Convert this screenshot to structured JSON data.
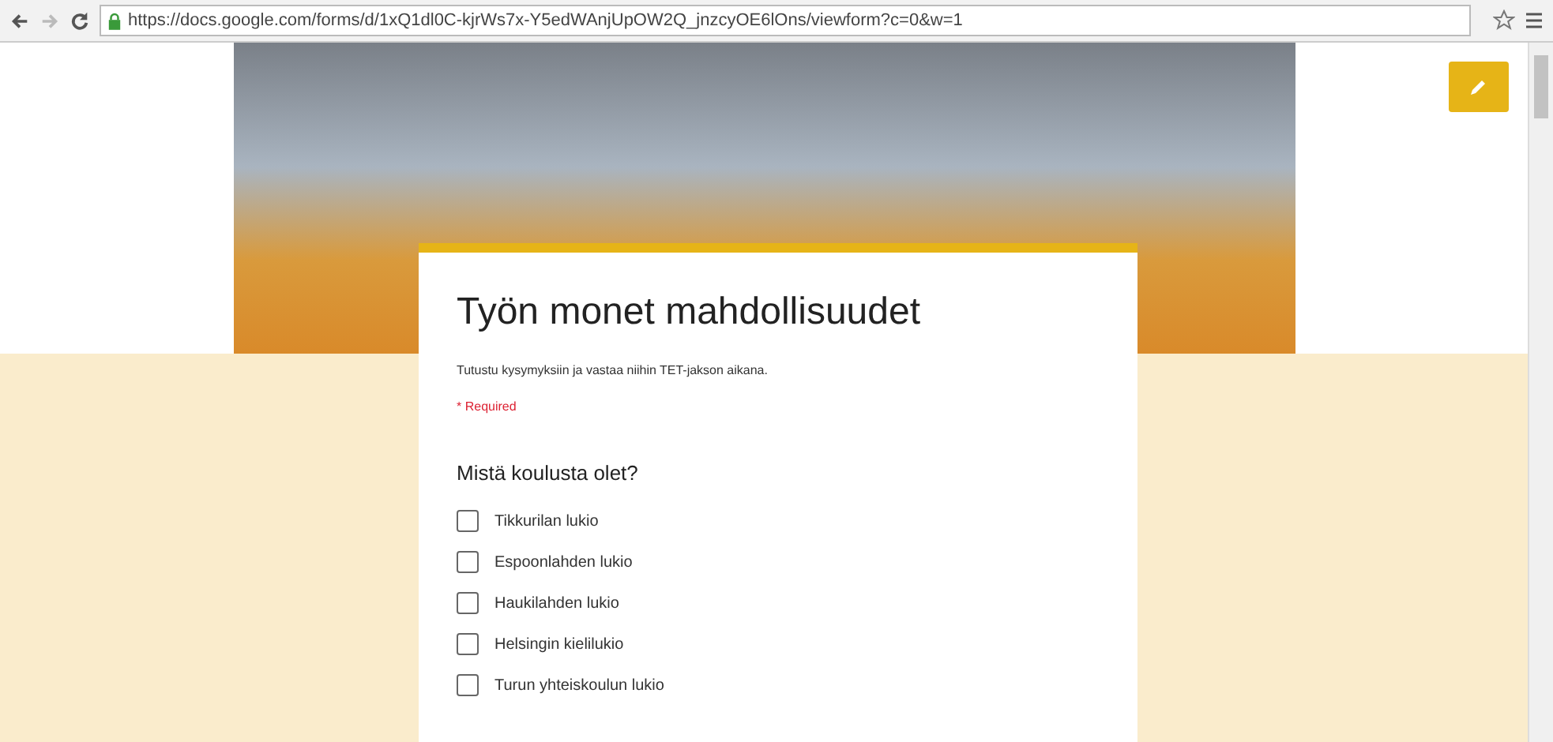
{
  "browser": {
    "url": "https://docs.google.com/forms/d/1xQ1dl0C-kjrWs7x-Y5edWAnjUpOW2Q_jnzcyOE6lOns/viewform?c=0&w=1"
  },
  "form": {
    "title": "Työn monet mahdollisuudet",
    "description": "Tutustu kysymyksiin ja vastaa niihin TET-jakson aikana.",
    "required_note": "* Required",
    "question": {
      "title": "Mistä koulusta olet?",
      "options": [
        {
          "label": "Tikkurilan lukio",
          "checked": false
        },
        {
          "label": "Espoonlahden lukio",
          "checked": false
        },
        {
          "label": "Haukilahden lukio",
          "checked": false
        },
        {
          "label": "Helsingin kielilukio",
          "checked": false
        },
        {
          "label": "Turun yhteiskoulun lukio",
          "checked": false
        }
      ]
    }
  }
}
